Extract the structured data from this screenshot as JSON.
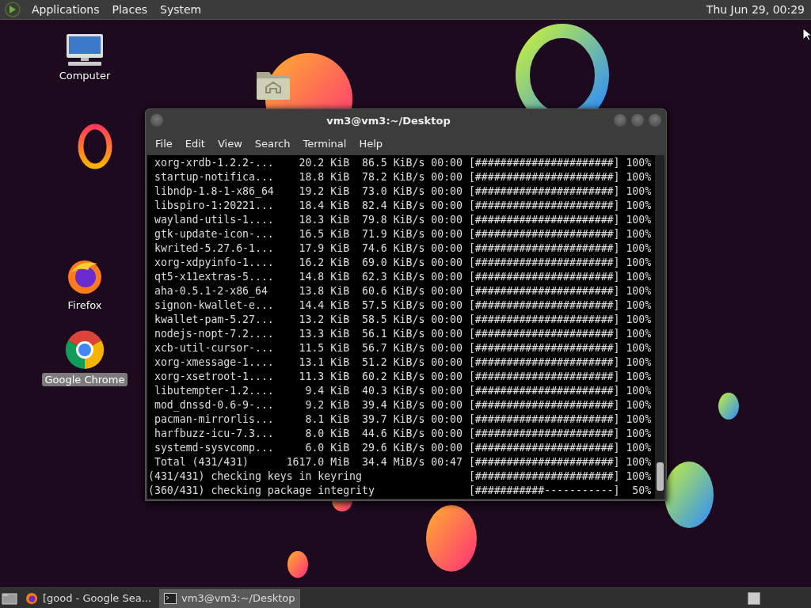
{
  "top_panel": {
    "menus": [
      "Applications",
      "Places",
      "System"
    ],
    "clock": "Thu Jun 29, 00:29"
  },
  "desktop_icons": [
    {
      "kind": "computer",
      "label": "Computer",
      "selected": false
    },
    {
      "kind": "home"
    },
    {
      "kind": "ring"
    },
    {
      "kind": "firefox",
      "label": "Firefox",
      "selected": false
    },
    {
      "kind": "chrome",
      "label": "Google Chrome",
      "selected": true
    }
  ],
  "window": {
    "title": "vm3@vm3:~/Desktop",
    "menu": [
      "File",
      "Edit",
      "View",
      "Search",
      "Terminal",
      "Help"
    ],
    "rows": [
      {
        "name": "xorg-xrdb-1.2.2-...",
        "size": "20.2 KiB",
        "speed": "86.5 KiB/s",
        "time": "00:00",
        "bar": "[######################]",
        "percent": "100%"
      },
      {
        "name": "startup-notifica...",
        "size": "18.8 KiB",
        "speed": "78.2 KiB/s",
        "time": "00:00",
        "bar": "[######################]",
        "percent": "100%"
      },
      {
        "name": "libndp-1.8-1-x86_64",
        "size": "19.2 KiB",
        "speed": "73.0 KiB/s",
        "time": "00:00",
        "bar": "[######################]",
        "percent": "100%"
      },
      {
        "name": "libspiro-1:20221...",
        "size": "18.4 KiB",
        "speed": "82.4 KiB/s",
        "time": "00:00",
        "bar": "[######################]",
        "percent": "100%"
      },
      {
        "name": "wayland-utils-1....",
        "size": "18.3 KiB",
        "speed": "79.8 KiB/s",
        "time": "00:00",
        "bar": "[######################]",
        "percent": "100%"
      },
      {
        "name": "gtk-update-icon-...",
        "size": "16.5 KiB",
        "speed": "71.9 KiB/s",
        "time": "00:00",
        "bar": "[######################]",
        "percent": "100%"
      },
      {
        "name": "kwrited-5.27.6-1...",
        "size": "17.9 KiB",
        "speed": "74.6 KiB/s",
        "time": "00:00",
        "bar": "[######################]",
        "percent": "100%"
      },
      {
        "name": "xorg-xdpyinfo-1....",
        "size": "16.2 KiB",
        "speed": "69.0 KiB/s",
        "time": "00:00",
        "bar": "[######################]",
        "percent": "100%"
      },
      {
        "name": "qt5-x11extras-5....",
        "size": "14.8 KiB",
        "speed": "62.3 KiB/s",
        "time": "00:00",
        "bar": "[######################]",
        "percent": "100%"
      },
      {
        "name": "aha-0.5.1-2-x86_64",
        "size": "13.8 KiB",
        "speed": "60.6 KiB/s",
        "time": "00:00",
        "bar": "[######################]",
        "percent": "100%"
      },
      {
        "name": "signon-kwallet-e...",
        "size": "14.4 KiB",
        "speed": "57.5 KiB/s",
        "time": "00:00",
        "bar": "[######################]",
        "percent": "100%"
      },
      {
        "name": "kwallet-pam-5.27...",
        "size": "13.2 KiB",
        "speed": "58.5 KiB/s",
        "time": "00:00",
        "bar": "[######################]",
        "percent": "100%"
      },
      {
        "name": "nodejs-nopt-7.2....",
        "size": "13.3 KiB",
        "speed": "56.1 KiB/s",
        "time": "00:00",
        "bar": "[######################]",
        "percent": "100%"
      },
      {
        "name": "xcb-util-cursor-...",
        "size": "11.5 KiB",
        "speed": "56.7 KiB/s",
        "time": "00:00",
        "bar": "[######################]",
        "percent": "100%"
      },
      {
        "name": "xorg-xmessage-1....",
        "size": "13.1 KiB",
        "speed": "51.2 KiB/s",
        "time": "00:00",
        "bar": "[######################]",
        "percent": "100%"
      },
      {
        "name": "xorg-xsetroot-1....",
        "size": "11.3 KiB",
        "speed": "60.2 KiB/s",
        "time": "00:00",
        "bar": "[######################]",
        "percent": "100%"
      },
      {
        "name": "libutempter-1.2....",
        "size": "9.4 KiB",
        "speed": "40.3 KiB/s",
        "time": "00:00",
        "bar": "[######################]",
        "percent": "100%"
      },
      {
        "name": "mod_dnssd-0.6-9-...",
        "size": "9.2 KiB",
        "speed": "39.4 KiB/s",
        "time": "00:00",
        "bar": "[######################]",
        "percent": "100%"
      },
      {
        "name": "pacman-mirrorlis...",
        "size": "8.1 KiB",
        "speed": "39.7 KiB/s",
        "time": "00:00",
        "bar": "[######################]",
        "percent": "100%"
      },
      {
        "name": "harfbuzz-icu-7.3...",
        "size": "8.0 KiB",
        "speed": "44.6 KiB/s",
        "time": "00:00",
        "bar": "[######################]",
        "percent": "100%"
      },
      {
        "name": "systemd-sysvcomp...",
        "size": "6.0 KiB",
        "speed": "29.6 KiB/s",
        "time": "00:00",
        "bar": "[######################]",
        "percent": "100%"
      },
      {
        "name": "Total (431/431)",
        "size": "1617.0 MiB",
        "speed": "34.4 MiB/s",
        "time": "00:47",
        "bar": "[######################]",
        "percent": "100%"
      }
    ],
    "status_lines": [
      {
        "text": "(431/431) checking keys in keyring",
        "bar": "[######################]",
        "percent": "100%"
      },
      {
        "text": "(360/431) checking package integrity",
        "bar": "[###########-----------]",
        "percent": "50%"
      }
    ]
  },
  "taskbar": {
    "tasks": [
      {
        "kind": "browser",
        "label": "[good - Google Sea...",
        "selected": false
      },
      {
        "kind": "terminal",
        "label": "vm3@vm3:~/Desktop",
        "selected": true
      }
    ]
  }
}
